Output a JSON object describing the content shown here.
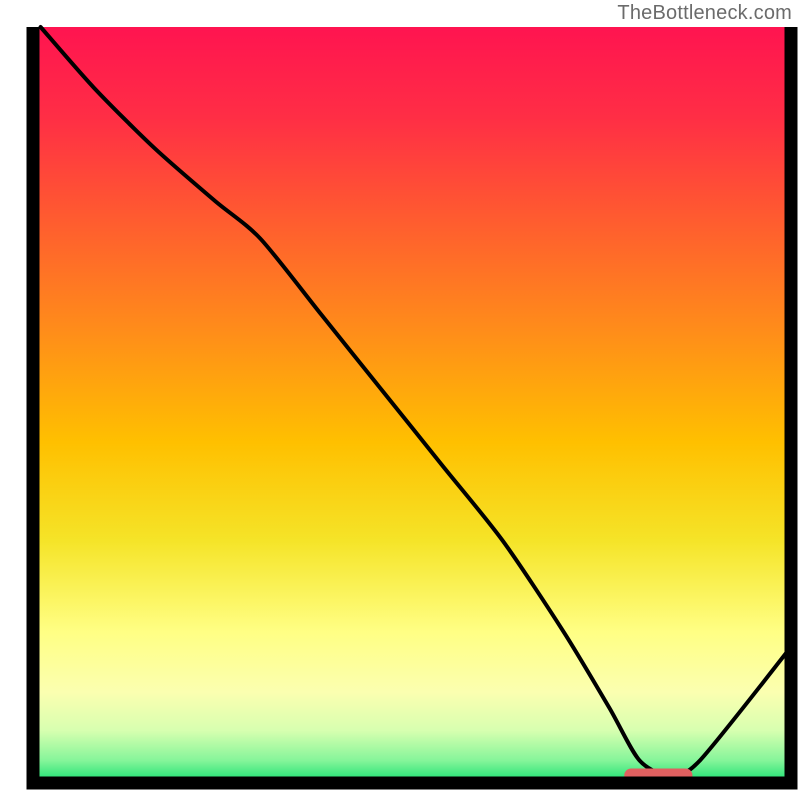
{
  "watermark": "TheBottleneck.com",
  "colors": {
    "border": "#000000",
    "curve": "#000000",
    "marker": "#e06060",
    "gradient_stops": [
      {
        "offset": 0.0,
        "color": "#ff1450"
      },
      {
        "offset": 0.12,
        "color": "#ff2e45"
      },
      {
        "offset": 0.25,
        "color": "#ff5a30"
      },
      {
        "offset": 0.4,
        "color": "#ff8c1a"
      },
      {
        "offset": 0.55,
        "color": "#ffc000"
      },
      {
        "offset": 0.68,
        "color": "#f5e428"
      },
      {
        "offset": 0.8,
        "color": "#ffff84"
      },
      {
        "offset": 0.88,
        "color": "#fbffb0"
      },
      {
        "offset": 0.93,
        "color": "#d8ffb0"
      },
      {
        "offset": 0.97,
        "color": "#86f59a"
      },
      {
        "offset": 1.0,
        "color": "#15e070"
      }
    ]
  },
  "chart_data": {
    "type": "line",
    "title": "",
    "xlabel": "",
    "ylabel": "",
    "xlim": [
      0,
      100
    ],
    "ylim": [
      0,
      100
    ],
    "grid": false,
    "legend": false,
    "series": [
      {
        "name": "bottleneck-curve",
        "x": [
          1,
          8,
          16,
          24,
          30,
          38,
          46,
          54,
          62,
          70,
          76,
          80,
          84,
          88,
          100
        ],
        "y": [
          100,
          92,
          84,
          77,
          72,
          62,
          52,
          42,
          32,
          20,
          10,
          3,
          1,
          3,
          18
        ]
      }
    ],
    "annotations": [
      {
        "name": "optimum-marker",
        "x_start": 78,
        "x_end": 87,
        "y": 1
      }
    ]
  }
}
